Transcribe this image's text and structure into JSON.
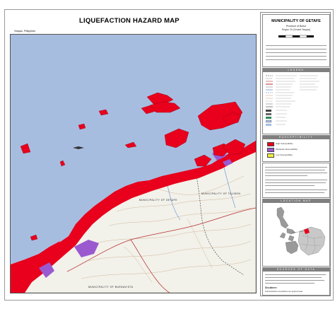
{
  "header": {
    "title": "LIQUEFACTION HAZARD MAP",
    "region": "Visayas, Philippines"
  },
  "title_block": {
    "municipality": "MUNICIPALITY OF GETAFE",
    "province": "Province of Bohol",
    "region": "Region VII (Central Visayas)"
  },
  "map_labels": {
    "municipality_getafe": "MUNICIPALITY OF GETAFE",
    "municipality_talibon": "MUNICIPALITY OF TALIBON",
    "municipality_buenavista": "MUNICIPALITY OF BUENAVISTA"
  },
  "section_heads": {
    "legend": "LEGEND",
    "susceptibility": "SUSCEPTIBILITY",
    "location": "LOCATION MAP",
    "sources": "SOURCES OF DATA"
  },
  "legend": {
    "items": [
      {
        "label": "High Susceptibility",
        "color": "#e8001c"
      },
      {
        "label": "Moderate Susceptibility",
        "color": "#9b59d0"
      },
      {
        "label": "Low Susceptibility",
        "color": "#f4ef3a"
      }
    ]
  },
  "disclaimer_head": "Disclaimer:",
  "disclaimer": "Administrative boundaries are approximate",
  "colors": {
    "sea": "#a7bde0",
    "land": "#f2f1ea",
    "high": "#e8001c",
    "moderate": "#9b59d0",
    "header_bar": "#7f7f7f"
  }
}
